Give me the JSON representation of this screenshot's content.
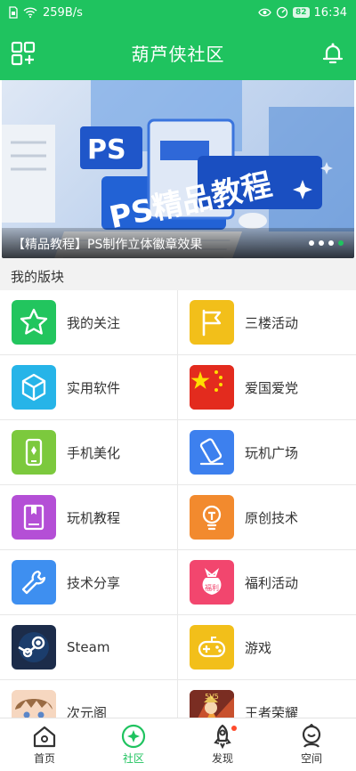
{
  "status_bar": {
    "speed": "259B/s",
    "battery": "82",
    "time": "16:34"
  },
  "header": {
    "title": "葫芦侠社区"
  },
  "banner": {
    "caption": "【精品教程】PS制作立体徽章效果",
    "art_text_1": "PS",
    "art_text_2": "PS精品教程",
    "dots": 4,
    "active_dot": 3
  },
  "section_title": "我的版块",
  "boards": [
    {
      "label": "我的关注",
      "icon": "star-icon",
      "color": "#22c55e"
    },
    {
      "label": "三楼活动",
      "icon": "flag-icon",
      "color": "#f2bf1a"
    },
    {
      "label": "实用软件",
      "icon": "cube-icon",
      "color": "#26b4e8"
    },
    {
      "label": "爱国爱党",
      "icon": "china-flag-icon",
      "color": "#e32b1e"
    },
    {
      "label": "手机美化",
      "icon": "phone-icon",
      "color": "#7cc93d"
    },
    {
      "label": "玩机广场",
      "icon": "tilted-phone-icon",
      "color": "#3d80ee"
    },
    {
      "label": "玩机教程",
      "icon": "book-icon",
      "color": "#b44fd6"
    },
    {
      "label": "原创技术",
      "icon": "bulb-icon",
      "color": "#f28a2e"
    },
    {
      "label": "技术分享",
      "icon": "wrench-icon",
      "color": "#3e8ff0"
    },
    {
      "label": "福利活动",
      "icon": "gift-bag-icon",
      "color": "#f2466e"
    },
    {
      "label": "Steam",
      "icon": "steam-icon",
      "color": "#1c2c4a"
    },
    {
      "label": "游戏",
      "icon": "gamepad-icon",
      "color": "#f2bf1a"
    },
    {
      "label": "次元阁",
      "icon": "anime-avatar-icon",
      "color": "#f6d7c0"
    },
    {
      "label": "王者荣耀",
      "icon": "honor-of-kings-icon",
      "color": "#7a2d22"
    }
  ],
  "nav": [
    {
      "label": "首页",
      "icon": "home-icon"
    },
    {
      "label": "社区",
      "icon": "community-icon",
      "active": true
    },
    {
      "label": "发现",
      "icon": "rocket-icon",
      "badge": true
    },
    {
      "label": "空间",
      "icon": "profile-icon"
    }
  ],
  "colors": {
    "brand": "#1fc35f",
    "badge": "#ff4a2b"
  }
}
